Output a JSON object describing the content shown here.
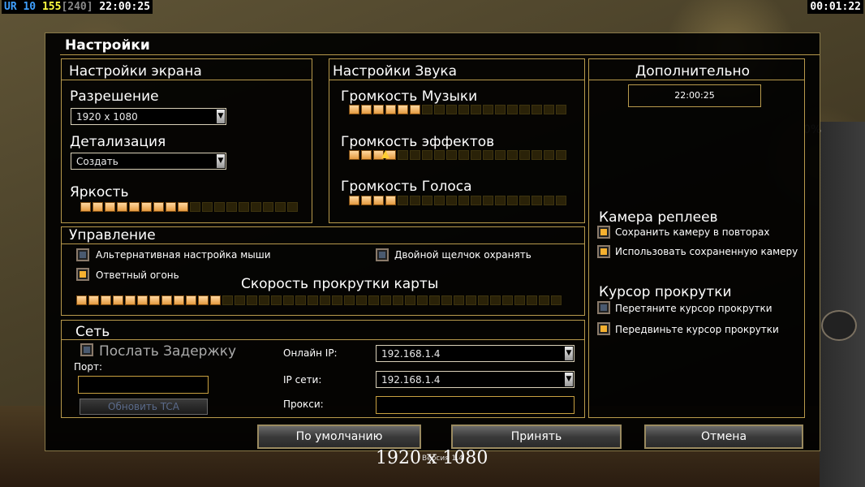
{
  "hud": {
    "prefix": "UR",
    "level": "10",
    "money": "155",
    "power": "[240]",
    "clock": "22:00:25",
    "timer": "00:01:22",
    "bg_percent": "0%"
  },
  "dialog": {
    "title": "Настройки"
  },
  "screen": {
    "title": "Настройки экрана",
    "resolution_label": "Разрешение",
    "resolution_value": "1920 x 1080",
    "detail_label": "Детализация",
    "detail_value": "Создать",
    "brightness_label": "Яркость",
    "brightness_level": 0.5
  },
  "sound": {
    "title": "Настройки Звука",
    "music_label": "Громкость Музыки",
    "music_level": 0.35,
    "effects_label": "Громкость эффектов",
    "effects_level": 0.2,
    "voice_label": "Громкость Голоса",
    "voice_level": 0.2
  },
  "extra": {
    "title": "Дополнительно",
    "clock": "22:00:25",
    "replay_camera_title": "Камера реплеев",
    "save_camera_label": "Сохранить камеру в повторах",
    "save_camera_checked": true,
    "use_saved_camera_label": "Использовать сохраненную камеру",
    "use_saved_camera_checked": true,
    "scroll_cursor_title": "Курсор прокрутки",
    "drag_cursor_label": "Перетяните курсор прокрутки",
    "drag_cursor_checked": false,
    "move_cursor_label": "Передвиньте курсор прокрутки",
    "move_cursor_checked": true
  },
  "control": {
    "title": "Управление",
    "alt_mouse_label": "Альтернативная настройка мыши",
    "alt_mouse_checked": false,
    "double_click_label": "Двойной щелчок охранять",
    "double_click_checked": false,
    "return_fire_label": "Ответный огонь",
    "return_fire_checked": true,
    "scroll_speed_label": "Скорость прокрутки карты",
    "scroll_speed_level": 0.3
  },
  "network": {
    "title": "Сеть",
    "send_delay_label": "Послать Задержку",
    "send_delay_checked": false,
    "port_label": "Порт:",
    "port_value": "",
    "refresh_button": "Обновить TCA",
    "online_ip_label": "Онлайн IP:",
    "online_ip_value": "192.168.1.4",
    "lan_ip_label": "IP сети:",
    "lan_ip_value": "192.168.1.4",
    "proxy_label": "Прокси:",
    "proxy_value": ""
  },
  "buttons": {
    "defaults": "По умолчанию",
    "accept": "Принять",
    "cancel": "Отмена"
  },
  "footer": {
    "resolution_caption": "1920 x 1080",
    "version": "Версия 1.4"
  },
  "colors": {
    "accent_border": "#b89a4c",
    "slider_on": "#f5b030",
    "hud_level": "#3fa0ff",
    "hud_money": "#ffff40"
  }
}
